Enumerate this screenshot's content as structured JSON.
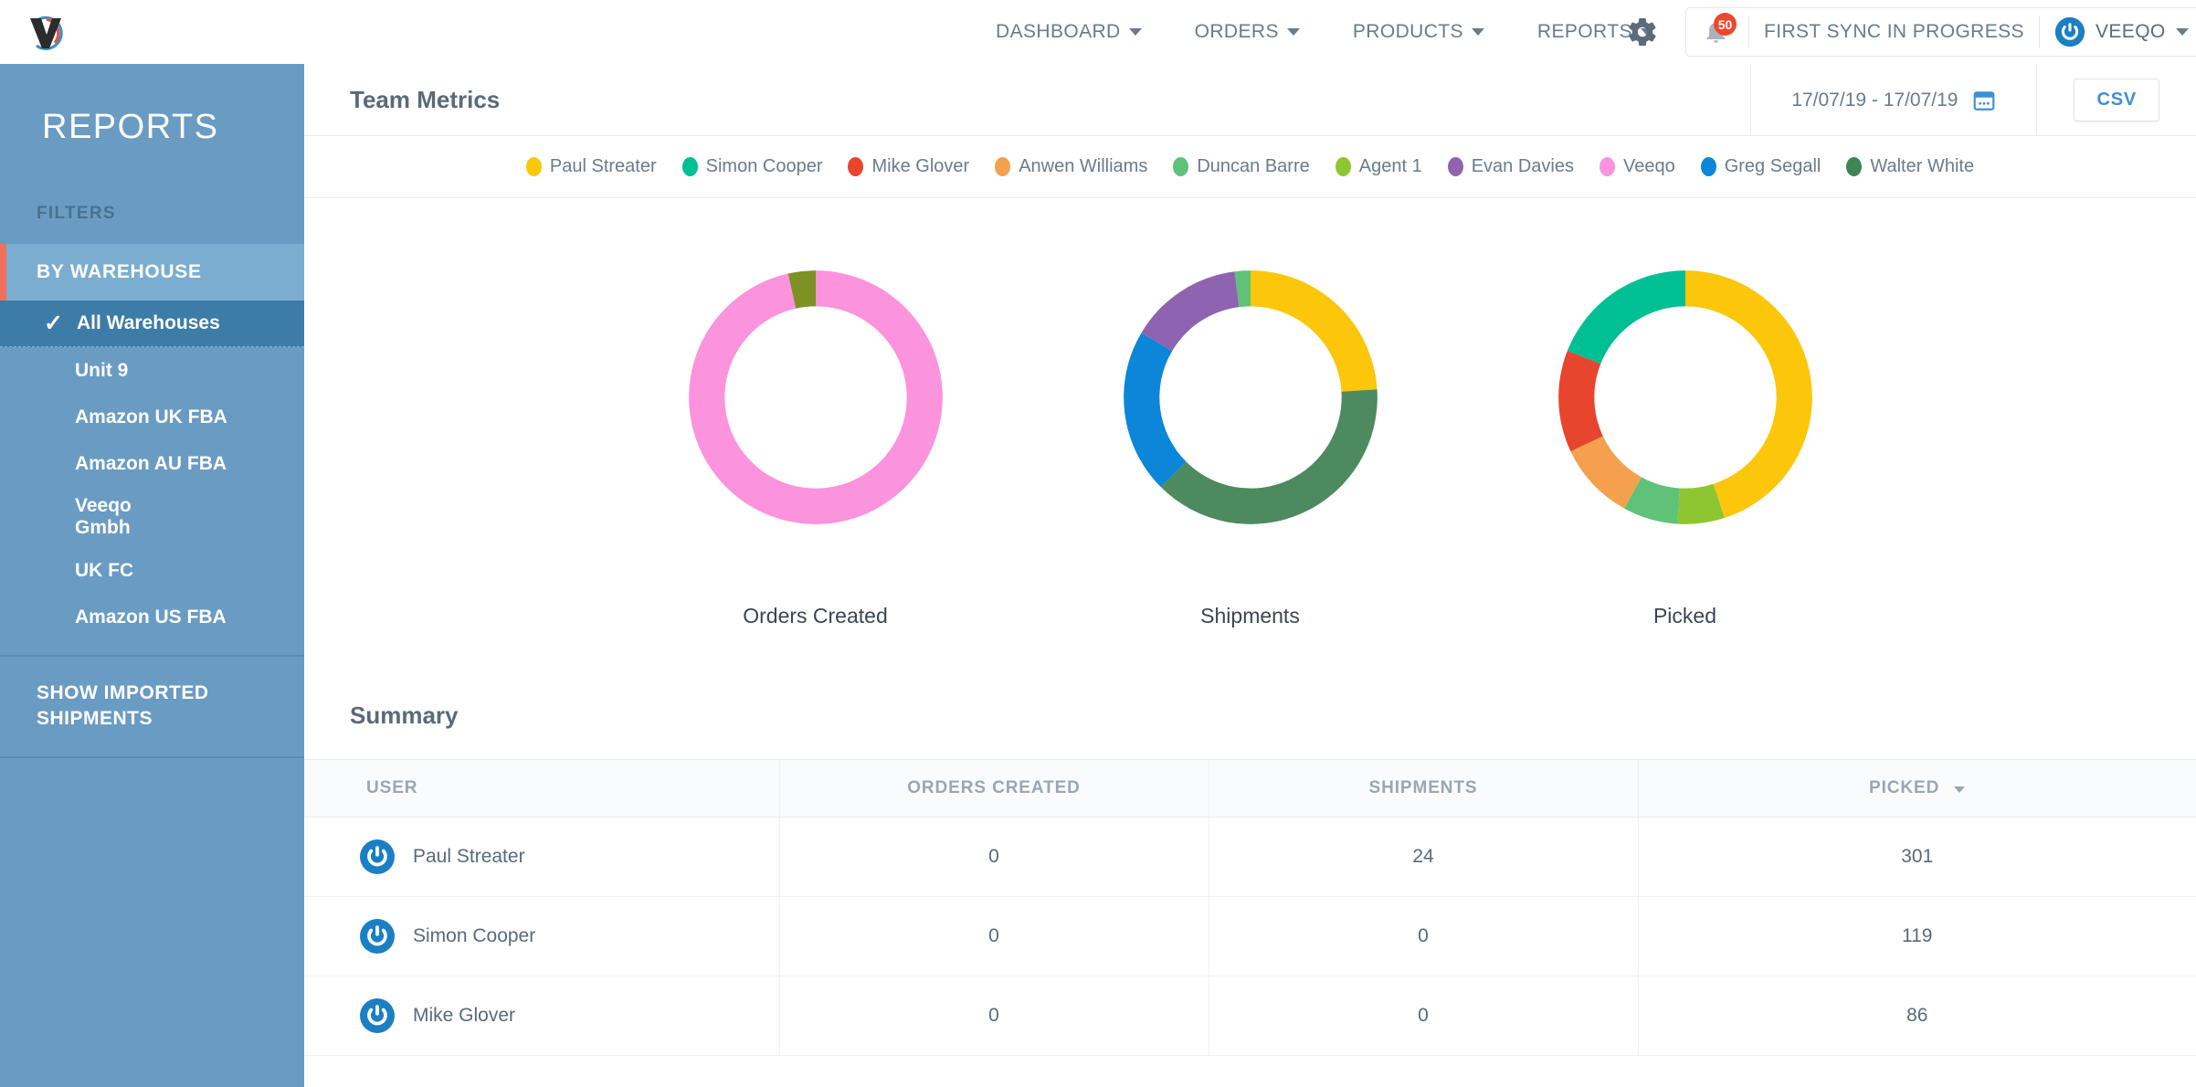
{
  "brand": {
    "logo_alt": "veeqo-logo",
    "accent_blue": "#1b7fc4",
    "accent_coral": "#f2705a"
  },
  "topnav": {
    "items": [
      {
        "label": "DASHBOARD",
        "icon": "chevron-down-icon"
      },
      {
        "label": "ORDERS",
        "icon": "chevron-down-icon"
      },
      {
        "label": "PRODUCTS",
        "icon": "chevron-down-icon"
      },
      {
        "label": "REPORTS",
        "icon": "chevron-down-icon"
      }
    ],
    "gear_icon": "gear-icon",
    "bell_icon": "bell-icon",
    "notification_count": "50",
    "sync_status": "FIRST SYNC IN PROGRESS",
    "account_name": "VEEQO",
    "account_caret": "chevron-down-icon"
  },
  "sidebar": {
    "title": "REPORTS",
    "filters_label": "FILTERS",
    "section_label": "BY WAREHOUSE",
    "items": [
      {
        "label": "All Warehouses",
        "selected": true
      },
      {
        "label": "Unit 9",
        "selected": false
      },
      {
        "label": "Amazon UK FBA",
        "selected": false
      },
      {
        "label": "Amazon AU FBA",
        "selected": false
      },
      {
        "label": "Veeqo Gmbh",
        "selected": false
      },
      {
        "label": "UK FC",
        "selected": false
      },
      {
        "label": "Amazon US FBA",
        "selected": false
      }
    ],
    "footer_label": "SHOW IMPORTED SHIPMENTS"
  },
  "header": {
    "title": "Team Metrics",
    "date_range": "17/07/19 - 17/07/19",
    "calendar_icon": "calendar-icon",
    "csv_label": "CSV"
  },
  "legend": [
    {
      "label": "Paul Streater",
      "color": "#fcc60b"
    },
    {
      "label": "Simon Cooper",
      "color": "#00bf94"
    },
    {
      "label": "Mike Glover",
      "color": "#e8452f"
    },
    {
      "label": "Anwen Williams",
      "color": "#f5a04e"
    },
    {
      "label": "Duncan Barre",
      "color": "#5fc278"
    },
    {
      "label": "Agent 1",
      "color": "#8ec631"
    },
    {
      "label": "Evan Davies",
      "color": "#8e64b0"
    },
    {
      "label": "Veeqo",
      "color": "#fb93dd"
    },
    {
      "label": "Greg Segall",
      "color": "#0b86d8"
    },
    {
      "label": "Walter White",
      "color": "#3f8555"
    }
  ],
  "chart_data": [
    {
      "type": "pie",
      "title": "Orders Created",
      "legend_position": "top",
      "categories": [
        "Veeqo",
        "Agent 1"
      ],
      "values": [
        96.5,
        3.5
      ],
      "colors": [
        "#fb93dd",
        "#7d9124"
      ]
    },
    {
      "type": "pie",
      "title": "Shipments",
      "legend_position": "top",
      "categories": [
        "Paul Streater",
        "Walter White",
        "Greg Segall",
        "Evan Davies",
        "Duncan Barre"
      ],
      "values": [
        24,
        38.5,
        21,
        14.5,
        2
      ],
      "colors": [
        "#fcc60b",
        "#4d8a5f",
        "#0b86d8",
        "#8e64b0",
        "#5fc278"
      ]
    },
    {
      "type": "pie",
      "title": "Picked",
      "legend_position": "top",
      "categories": [
        "Paul Streater",
        "Agent 1",
        "Duncan Barre",
        "Anwen Williams",
        "Mike Glover",
        "Simon Cooper"
      ],
      "values": [
        45,
        6,
        7,
        10,
        13,
        19
      ],
      "colors": [
        "#fcc60b",
        "#8ec631",
        "#5fc278",
        "#f5a04e",
        "#e8452f",
        "#00bf94"
      ]
    }
  ],
  "summary": {
    "title": "Summary",
    "columns": [
      "USER",
      "ORDERS CREATED",
      "SHIPMENTS",
      "PICKED"
    ],
    "sorted_column": "PICKED",
    "sort_direction": "desc",
    "rows": [
      {
        "user": "Paul Streater",
        "orders_created": "0",
        "shipments": "24",
        "picked": "301"
      },
      {
        "user": "Simon Cooper",
        "orders_created": "0",
        "shipments": "0",
        "picked": "119"
      },
      {
        "user": "Mike Glover",
        "orders_created": "0",
        "shipments": "0",
        "picked": "86"
      }
    ]
  }
}
